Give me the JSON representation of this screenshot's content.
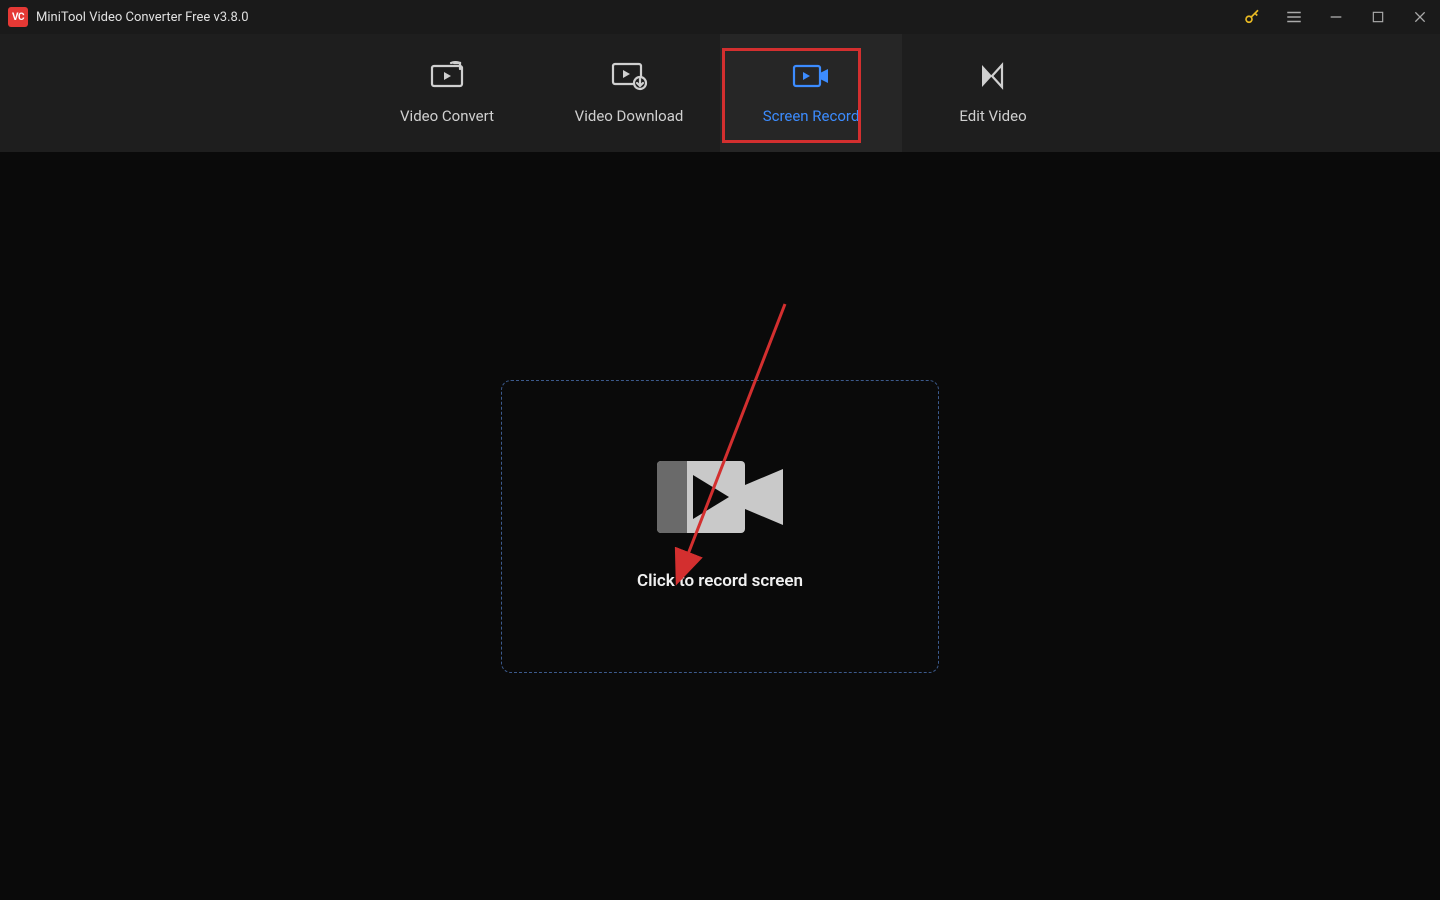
{
  "app": {
    "logo_text": "VC",
    "title": "MiniTool Video Converter Free v3.8.0"
  },
  "nav": {
    "items": [
      {
        "label": "Video Convert",
        "active": false
      },
      {
        "label": "Video Download",
        "active": false
      },
      {
        "label": "Screen Record",
        "active": true
      },
      {
        "label": "Edit Video",
        "active": false
      }
    ]
  },
  "main": {
    "record_prompt": "Click to record screen"
  }
}
